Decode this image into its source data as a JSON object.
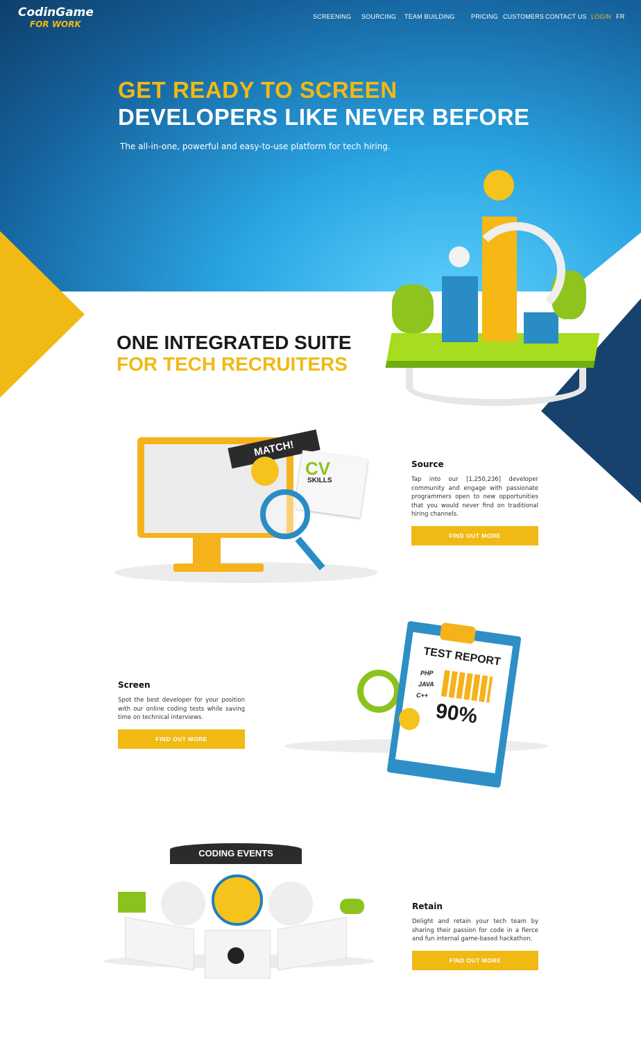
{
  "header": {
    "logo": "CodinGame",
    "logo_sub": "FOR WORK",
    "nav": [
      "SCREENING",
      "SOURCING",
      "TEAM BUILDING",
      "PRICING",
      "CUSTOMERS",
      "CONTACT US",
      "LOGIN",
      "FR"
    ]
  },
  "hero": {
    "title_line1": "GET READY TO SCREEN",
    "title_line2": "DEVELOPERS LIKE NEVER BEFORE",
    "tagline": "The all-in-one, powerful and easy-to-use platform for tech hiring."
  },
  "suite": {
    "line1": "ONE INTEGRATED SUITE",
    "line2": "FOR TECH RECRUITERS"
  },
  "sections": [
    {
      "title": "Source",
      "text": "Tap into our [1,250,236] developer community and engage with passionate programmers open to new opportunities that you would never find on traditional hiring channels.",
      "button": "FIND OUT  MORE"
    },
    {
      "title": "Screen",
      "text": "Spot the best developer for your position with our online coding tests while saving time on technical interviews.",
      "button": "FIND OUT  MORE"
    },
    {
      "title": "Retain",
      "text": "Delight and retain your tech team by sharing their passion for code in a fierce and fun internal game-based hackathon.",
      "button": "FIND OUT  MORE"
    }
  ],
  "illustrations": {
    "match": "MATCH!",
    "cv": "CV",
    "skills": "SKILLS",
    "report_title": "TEST REPORT",
    "langs": [
      "PHP",
      "JAVA",
      "C++"
    ],
    "score": "90%",
    "events": "CODING EVENTS"
  },
  "colors": {
    "accent": "#f0b914",
    "hero_blue": "#2aa5e3",
    "dark_blue": "#17426e"
  }
}
